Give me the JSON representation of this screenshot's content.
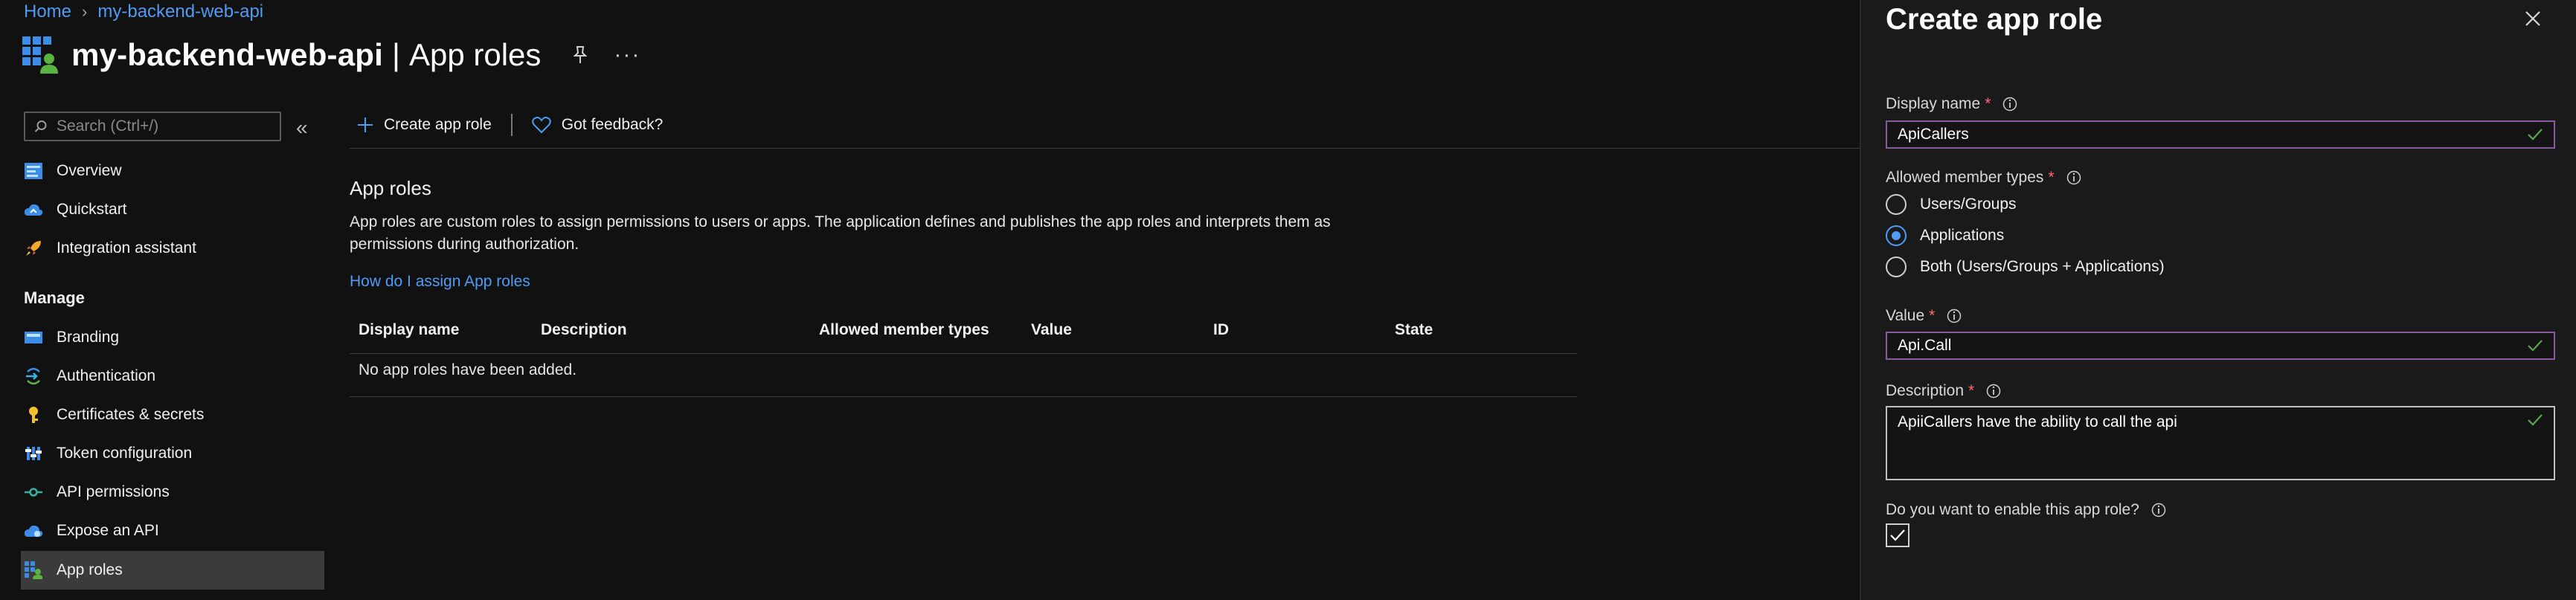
{
  "breadcrumb": {
    "home": "Home",
    "current": "my-backend-web-api"
  },
  "header": {
    "app_name": "my-backend-web-api",
    "separator": "|",
    "page": "App roles",
    "more": "···"
  },
  "search": {
    "placeholder": "Search (Ctrl+/)"
  },
  "nav": {
    "collapse": "«",
    "items_top": [
      {
        "label": "Overview",
        "icon": "overview-icon"
      },
      {
        "label": "Quickstart",
        "icon": "quickstart-cloud-icon"
      },
      {
        "label": "Integration assistant",
        "icon": "rocket-icon"
      }
    ],
    "section_label": "Manage",
    "items_manage": [
      {
        "label": "Branding",
        "icon": "branding-icon"
      },
      {
        "label": "Authentication",
        "icon": "authentication-icon"
      },
      {
        "label": "Certificates & secrets",
        "icon": "key-icon"
      },
      {
        "label": "Token configuration",
        "icon": "token-icon"
      },
      {
        "label": "API permissions",
        "icon": "api-permissions-icon"
      },
      {
        "label": "Expose an API",
        "icon": "cloud-icon"
      },
      {
        "label": "App roles",
        "icon": "app-roles-icon",
        "active": true
      }
    ]
  },
  "toolbar": {
    "create_label": "Create app role",
    "feedback_label": "Got feedback?"
  },
  "main": {
    "section_title": "App roles",
    "description": "App roles are custom roles to assign permissions to users or apps. The application defines and publishes the app roles and interprets them as permissions during authorization.",
    "link": "How do I assign App roles",
    "table": {
      "columns": [
        "Display name",
        "Description",
        "Allowed member types",
        "Value",
        "ID",
        "State"
      ],
      "empty_message": "No app roles have been added."
    }
  },
  "panel": {
    "title": "Create app role",
    "display_name": {
      "label": "Display name",
      "required": "*",
      "value": "ApiCallers"
    },
    "member_types": {
      "label": "Allowed member types",
      "required": "*",
      "options": [
        "Users/Groups",
        "Applications",
        "Both (Users/Groups + Applications)"
      ],
      "selected": "Applications"
    },
    "value": {
      "label": "Value",
      "required": "*",
      "value": "Api.Call"
    },
    "description": {
      "label": "Description",
      "required": "*",
      "value": "ApiiCallers have the ability to call the api"
    },
    "enable": {
      "label": "Do you want to enable this app role?",
      "checked": true
    }
  },
  "colors": {
    "accent": "#4f9bf5",
    "valid": "#57a64a",
    "required": "#ff6b6b",
    "focus_border": "#8a5a9e"
  }
}
